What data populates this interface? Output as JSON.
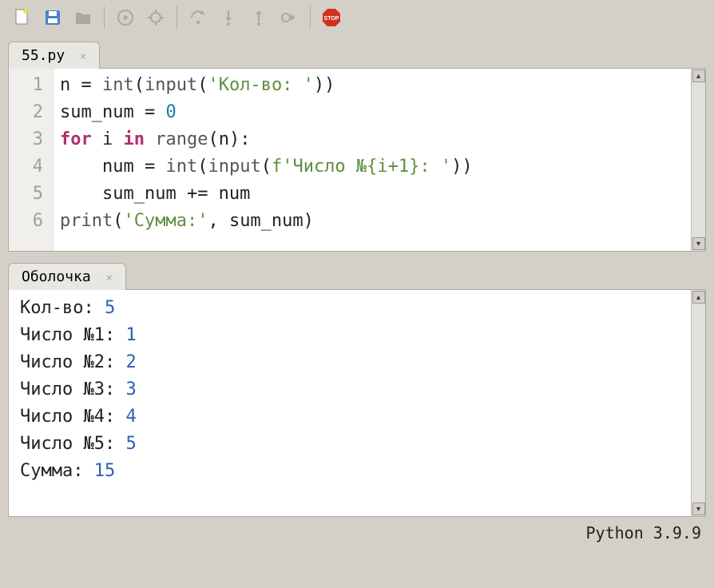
{
  "toolbar": {
    "icons": [
      "new-file-icon",
      "save-icon",
      "folder-icon",
      "divider",
      "play-icon",
      "debug-icon",
      "divider",
      "step-over-icon",
      "step-in-icon",
      "step-out-icon",
      "resume-icon",
      "divider",
      "stop-icon"
    ]
  },
  "editor": {
    "tab": {
      "label": "55.py",
      "close": "×"
    },
    "lines": [
      "1",
      "2",
      "3",
      "4",
      "5",
      "6"
    ],
    "code": {
      "l1": {
        "a": "n = ",
        "fn1": "int",
        "b": "(",
        "fn2": "input",
        "c": "(",
        "str": "'Кол-во: '",
        "d": "))"
      },
      "l2": {
        "a": "sum_num = ",
        "num": "0"
      },
      "l3": {
        "kw1": "for",
        "a": " i ",
        "kw2": "in",
        "b": " ",
        "fn": "range",
        "c": "(n):"
      },
      "l4": {
        "indent": "    ",
        "a": "num = ",
        "fn1": "int",
        "b": "(",
        "fn2": "input",
        "c": "(",
        "fpre": "f",
        "str": "'Число №{i+1}: '",
        "d": "))"
      },
      "l5": {
        "indent": "    ",
        "a": "sum_num += num"
      },
      "l6": {
        "fn": "print",
        "a": "(",
        "str": "'Сумма:'",
        "b": ", sum_num)"
      }
    }
  },
  "shell": {
    "tab": {
      "label": "Оболочка",
      "close": "×"
    },
    "rows": [
      {
        "label": "Кол-во: ",
        "value": "5"
      },
      {
        "label": "Число №1: ",
        "value": "1"
      },
      {
        "label": "Число №2: ",
        "value": "2"
      },
      {
        "label": "Число №3: ",
        "value": "3"
      },
      {
        "label": "Число №4: ",
        "value": "4"
      },
      {
        "label": "Число №5: ",
        "value": "5"
      },
      {
        "label": "Сумма: ",
        "value": "15"
      }
    ]
  },
  "status": {
    "python": "Python 3.9.9"
  }
}
